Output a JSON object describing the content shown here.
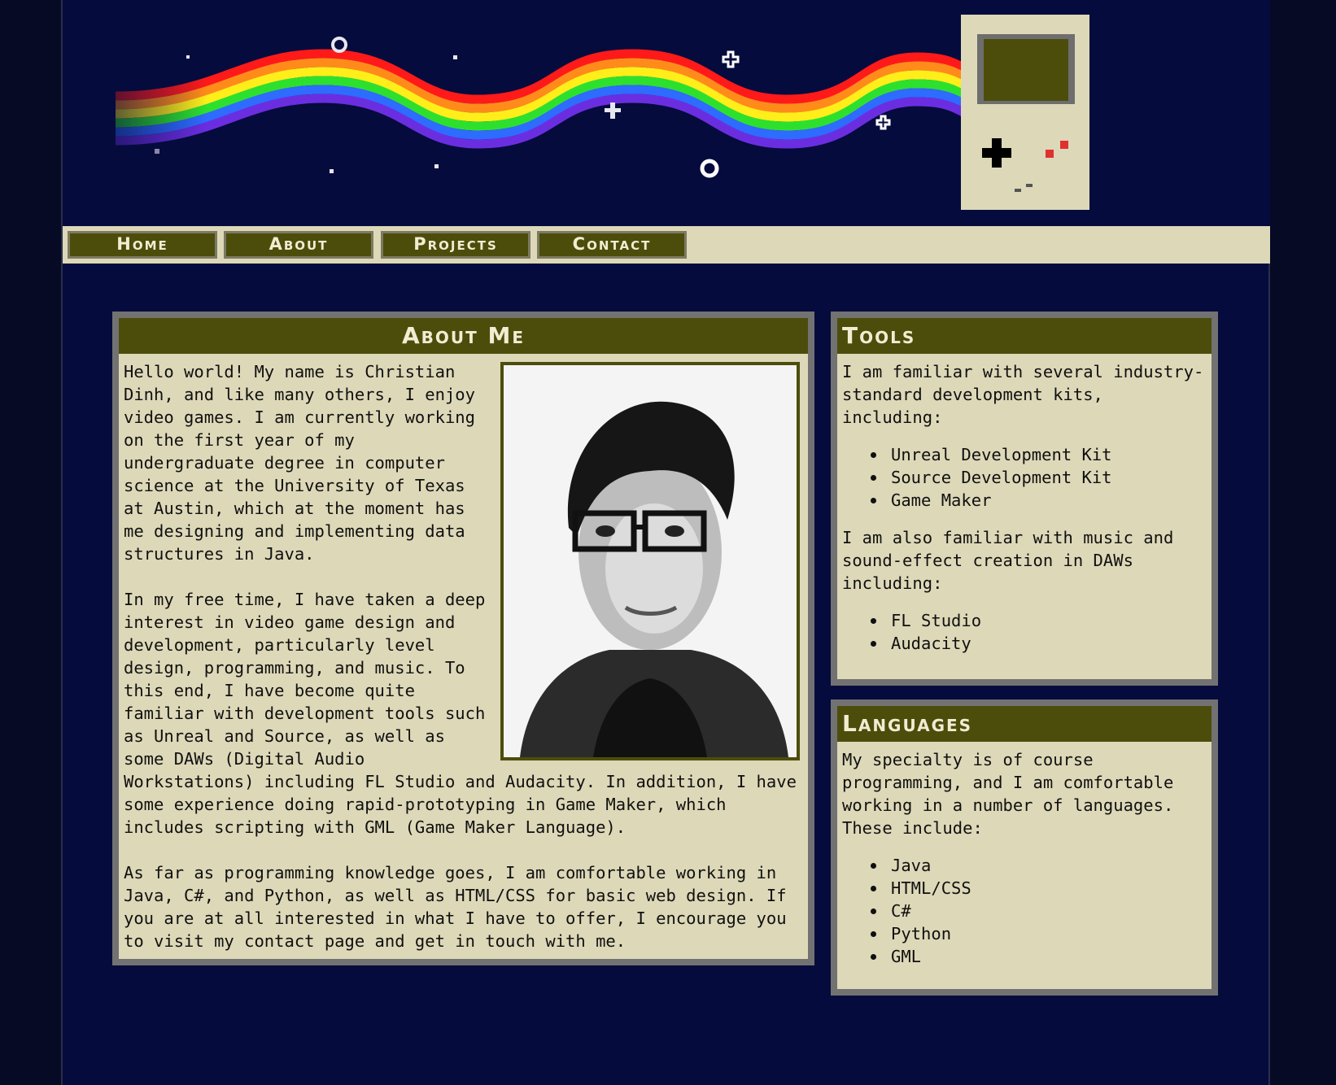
{
  "nav": {
    "items": [
      {
        "label": "Home"
      },
      {
        "label": "About"
      },
      {
        "label": "Projects"
      },
      {
        "label": "Contact"
      }
    ]
  },
  "about": {
    "title": "About Me",
    "paragraphs": [
      "Hello world! My name is Christian Dinh, and like many others, I enjoy video games. I am currently working on the first year of my undergraduate degree in computer science at the University of Texas at Austin, which at the moment has me designing and implementing data structures in Java.",
      "In my free time, I have taken a deep interest in video game design and development, particularly level design, programming, and music. To this end, I have become quite familiar with development tools such as Unreal and Source, as well as some DAWs (Digital Audio Workstations) including FL Studio and Audacity. In addition, I have some experience doing rapid-prototyping in Game Maker, which includes scripting with GML (Game Maker Language).",
      "As far as programming knowledge goes, I am comfortable working in Java, C#, and Python, as well as HTML/CSS for basic web design. If you are at all interested in what I have to offer, I encourage you to visit my contact page and get in touch with me."
    ]
  },
  "tools": {
    "title": "Tools",
    "intro": "I am familiar with several industry-standard development kits, including:",
    "kits": [
      "Unreal Development Kit",
      "Source Development Kit",
      "Game Maker"
    ],
    "intro2": "I am also familiar with music and sound-effect creation in DAWs including:",
    "daws": [
      "FL Studio",
      "Audacity"
    ]
  },
  "languages": {
    "title": "Languages",
    "intro": "My specialty is of course programming, and I am comfortable working in a number of languages. These include:",
    "items": [
      "Java",
      "HTML/CSS",
      "C#",
      "Python",
      "GML"
    ]
  },
  "colors": {
    "page_bg": "#050b3d",
    "panel_bg": "#ddd8b8",
    "panel_head": "#4c4d0b",
    "panel_border": "#727272"
  }
}
